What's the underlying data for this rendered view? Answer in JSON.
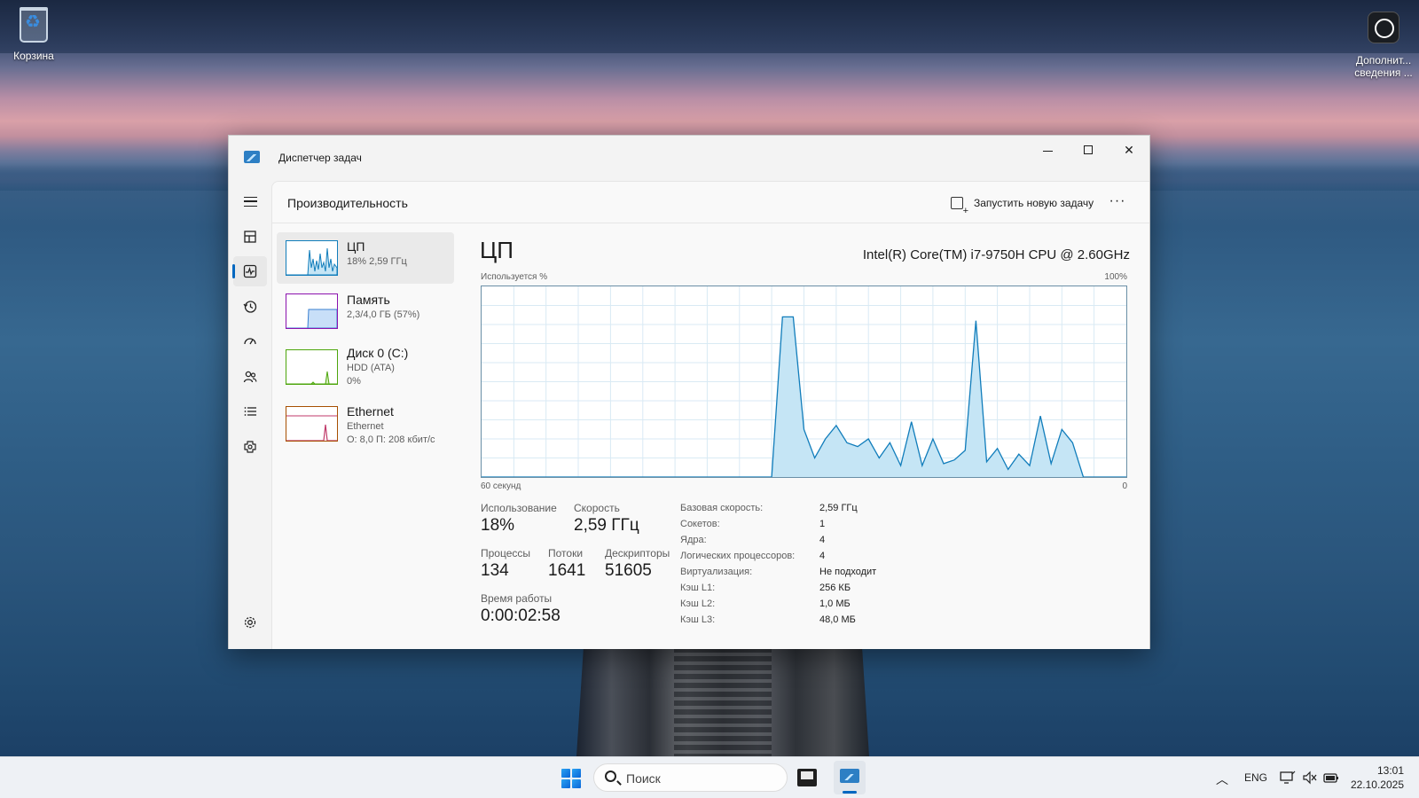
{
  "desktop": {
    "icons": [
      {
        "label": "Корзина"
      },
      {
        "label": "Дополнит... сведения ..."
      }
    ]
  },
  "window": {
    "title": "Диспетчер задач"
  },
  "nav": {
    "items": [
      {
        "icon": "hamburger-menu-icon"
      },
      {
        "icon": "processes-icon"
      },
      {
        "icon": "performance-icon",
        "active": true
      },
      {
        "icon": "app-history-icon"
      },
      {
        "icon": "startup-apps-icon"
      },
      {
        "icon": "users-icon"
      },
      {
        "icon": "details-icon"
      },
      {
        "icon": "services-icon"
      },
      {
        "icon": "settings-icon"
      }
    ]
  },
  "header": {
    "title": "Производительность",
    "run_task_label": "Запустить новую задачу",
    "more_label": "···"
  },
  "resources": [
    {
      "name": "ЦП",
      "sub1": "18% 2,59 ГГц",
      "sub2": ""
    },
    {
      "name": "Память",
      "sub1": "2,3/4,0 ГБ (57%)",
      "sub2": ""
    },
    {
      "name": "Диск 0 (C:)",
      "sub1": "HDD (ATA)",
      "sub2": "0%"
    },
    {
      "name": "Ethernet",
      "sub1": "Ethernet",
      "sub2": "О: 8,0 П: 208 кбит/с"
    }
  ],
  "detail": {
    "title": "ЦП",
    "model": "Intel(R) Core(TM) i7-9750H CPU @ 2.60GHz",
    "graph_label": "Используется %",
    "graph_max": "100%",
    "graph_time": "60 секунд",
    "graph_zero": "0",
    "stats": {
      "usage_label": "Использование",
      "usage": "18%",
      "speed_label": "Скорость",
      "speed": "2,59 ГГц",
      "processes_label": "Процессы",
      "processes": "134",
      "threads_label": "Потоки",
      "threads": "1641",
      "handles_label": "Дескрипторы",
      "handles": "51605",
      "uptime_label": "Время работы",
      "uptime": "0:00:02:58"
    },
    "info": [
      {
        "label": "Базовая скорость:",
        "value": "2,59 ГГц"
      },
      {
        "label": "Сокетов:",
        "value": "1"
      },
      {
        "label": "Ядра:",
        "value": "4"
      },
      {
        "label": "Логических процессоров:",
        "value": "4"
      },
      {
        "label": "Виртуализация:",
        "value": "Не подходит"
      },
      {
        "label": "Кэш L1:",
        "value": "256 КБ"
      },
      {
        "label": "Кэш L2:",
        "value": "1,0 МБ"
      },
      {
        "label": "Кэш L3:",
        "value": "48,0 МБ"
      }
    ]
  },
  "chart_data": {
    "type": "area",
    "ylim": [
      0,
      100
    ],
    "x": [
      0,
      1,
      2,
      3,
      4,
      5,
      6,
      7,
      8,
      9,
      10,
      11,
      12,
      13,
      14,
      15,
      16,
      17,
      18,
      19,
      20,
      21,
      22,
      23,
      24,
      25,
      26,
      27,
      28,
      29,
      30,
      31,
      32,
      33,
      34,
      35,
      36,
      37,
      38,
      39,
      40,
      41,
      42,
      43,
      44,
      45,
      46,
      47,
      48,
      49,
      50,
      51,
      52,
      53,
      54,
      55,
      56,
      57,
      58,
      59,
      60
    ],
    "values": [
      0,
      0,
      0,
      0,
      0,
      0,
      0,
      0,
      0,
      0,
      0,
      0,
      0,
      0,
      0,
      0,
      0,
      0,
      0,
      0,
      0,
      0,
      0,
      0,
      0,
      0,
      0,
      0,
      84,
      84,
      25,
      10,
      20,
      27,
      18,
      16,
      20,
      10,
      18,
      6,
      29,
      6,
      20,
      7,
      9,
      14,
      82,
      8,
      15,
      4,
      12,
      6,
      32,
      7,
      25,
      18,
      0,
      0,
      0,
      0,
      0
    ],
    "color": "#117dbb",
    "fill": "#c5e5f5"
  },
  "taskbar": {
    "search_placeholder": "Поиск",
    "lang": "ENG",
    "time": "13:01",
    "date": "22.10.2025"
  },
  "colors": {
    "accent": "#0067c0",
    "cpu_line": "#117dbb",
    "memory_line": "#8b12ae",
    "disk_line": "#4da60c",
    "ethernet_line": "#a74f01"
  }
}
